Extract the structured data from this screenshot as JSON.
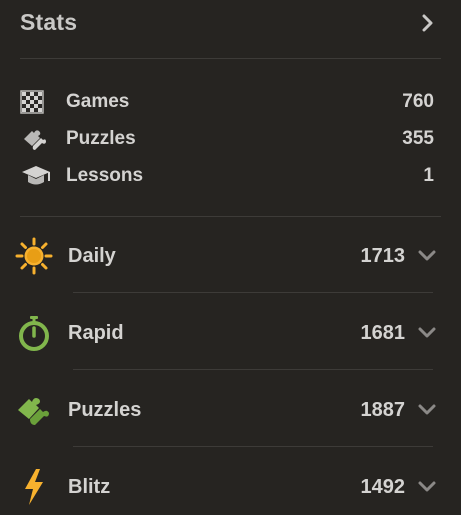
{
  "header": {
    "title": "Stats",
    "chevron_icon": "chevron-right-icon"
  },
  "summary": [
    {
      "label": "Games",
      "value": "760",
      "icon": "chessboard-icon"
    },
    {
      "label": "Puzzles",
      "value": "355",
      "icon": "puzzle-piece-icon"
    },
    {
      "label": "Lessons",
      "value": "1",
      "icon": "graduation-cap-icon"
    }
  ],
  "ratings": [
    {
      "label": "Daily",
      "value": "1713",
      "icon": "sun-icon",
      "color": "#f7b12e"
    },
    {
      "label": "Rapid",
      "value": "1681",
      "icon": "stopwatch-icon",
      "color": "#81b64c"
    },
    {
      "label": "Puzzles",
      "value": "1887",
      "icon": "puzzle-icon",
      "color": "#81b64c"
    },
    {
      "label": "Blitz",
      "value": "1492",
      "icon": "lightning-icon",
      "color": "#f7b12e"
    }
  ],
  "colors": {
    "background": "#262421",
    "text": "#d4d3d1",
    "divider": "#3d3b38",
    "chevron": "#8b8987"
  }
}
